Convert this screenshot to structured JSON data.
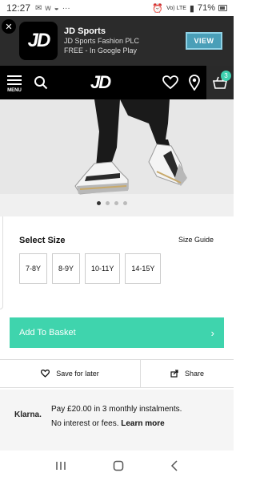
{
  "status_bar": {
    "time": "12:27",
    "battery": "71%",
    "network": "Vo) LTE"
  },
  "app_banner": {
    "logo_text": "JD",
    "name": "JD Sports",
    "publisher": "JD Sports Fashion PLC",
    "subtitle": "FREE - In Google Play",
    "view_label": "VIEW"
  },
  "header": {
    "menu_label": "MENU",
    "logo_text": "JD",
    "basket_count": "3"
  },
  "gallery": {
    "dot_count": 4,
    "active_index": 0
  },
  "size_section": {
    "title": "Select Size",
    "guide_label": "Size Guide",
    "sizes": [
      "7-8Y",
      "8-9Y",
      "10-11Y",
      "14-15Y"
    ]
  },
  "add_to_basket": {
    "label": "Add To Basket",
    "chevron": "›"
  },
  "actions": {
    "save_label": "Save for later",
    "share_label": "Share"
  },
  "klarna": {
    "logo": "Klarna.",
    "line1": "Pay £20.00 in 3 monthly instalments.",
    "line2": "No interest or fees.",
    "learn_more": "Learn more"
  },
  "colors": {
    "accent": "#3fd4ad",
    "banner_bg": "#2b2b2b",
    "header_bg": "#000000",
    "view_button": "#4a9fb8"
  }
}
